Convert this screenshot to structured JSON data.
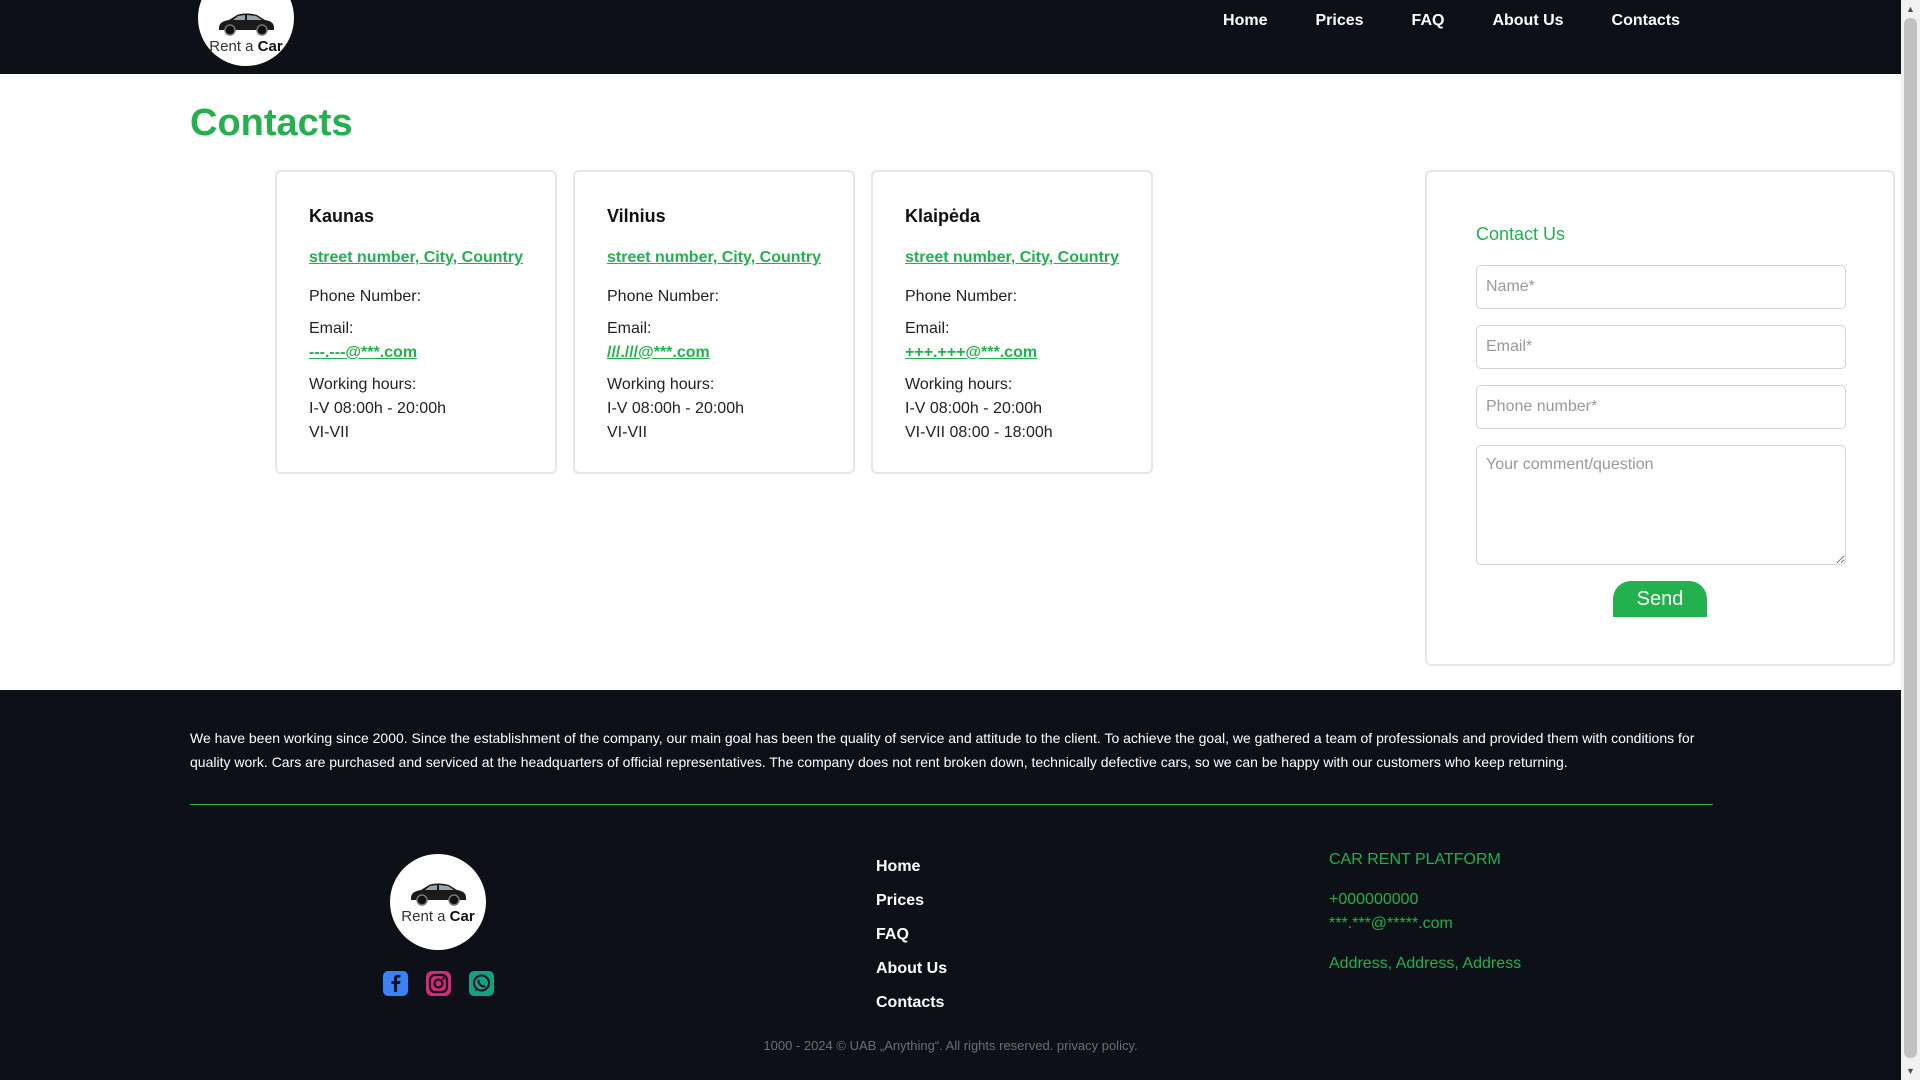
{
  "header": {
    "logo": {
      "prefix": "Rent a",
      "brand": "Car"
    },
    "nav": [
      "Home",
      "Prices",
      "FAQ",
      "About Us",
      "Contacts"
    ]
  },
  "page_title": "Contacts",
  "cards": [
    {
      "city": "Kaunas",
      "address": "street number, City, Country",
      "phone_label": "Phone Number:",
      "email_label": "Email:",
      "email": "---.---@***.com",
      "hours_label": "Working hours:",
      "hours_weekdays": "I-V 08:00h - 20:00h",
      "hours_weekend": "VI-VII"
    },
    {
      "city": "Vilnius",
      "address": "street number, City, Country",
      "phone_label": "Phone Number:",
      "email_label": "Email:",
      "email": "///.///@***.com",
      "hours_label": "Working hours:",
      "hours_weekdays": "I-V 08:00h - 20:00h",
      "hours_weekend": "VI-VII"
    },
    {
      "city": "Klaipėda",
      "address": "street number, City, Country",
      "phone_label": "Phone Number:",
      "email_label": "Email:",
      "email": "+++.+++@***.com",
      "hours_label": "Working hours:",
      "hours_weekdays": "I-V 08:00h - 20:00h",
      "hours_weekend": "VI-VII 08:00 - 18:00h"
    }
  ],
  "contact_form": {
    "title": "Contact Us",
    "name_placeholder": "Name*",
    "email_placeholder": "Email*",
    "phone_placeholder": "Phone number*",
    "comment_placeholder": "Your comment/question",
    "send_label": "Send"
  },
  "footer": {
    "about": "We have been working since 2000. Since the establishment of the company, our main goal has been the quality of service and attitude to the client. To achieve the goal, we gathered a team of professionals and provided them with conditions for quality work. Cars are purchased and serviced at the headquarters of official representatives. The company does not rent broken down, technically defective cars, so we can be happy with our customers who keep returning.",
    "logo": {
      "prefix": "Rent a",
      "brand": "Car"
    },
    "socials": [
      "facebook-icon",
      "instagram-icon",
      "whatsapp-icon"
    ],
    "links": [
      "Home",
      "Prices",
      "FAQ",
      "About Us",
      "Contacts"
    ],
    "company": "CAR RENT PLATFORM",
    "phone": "+000000000",
    "email": "***.***@*****.com",
    "address": "Address, Address, Address",
    "copyright": "1000 - 2024 © UAB „Anything“. All rights reserved. privacy policy."
  },
  "colors": {
    "accent": "#22b14c",
    "dark": "#0d1117"
  }
}
